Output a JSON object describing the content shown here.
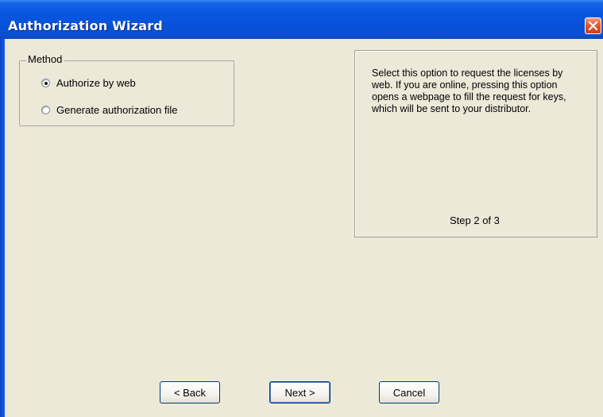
{
  "window": {
    "title": "Authorization Wizard"
  },
  "method_group": {
    "legend": "Method",
    "options": [
      {
        "label": "Authorize by web",
        "checked": true
      },
      {
        "label": "Generate authorization file",
        "checked": false
      }
    ]
  },
  "info_panel": {
    "description": "Select this option to request the licenses by web.  If you are online, pressing this option opens a webpage to fill the request for keys, which will be sent to your distributor.",
    "step": "Step 2 of 3"
  },
  "buttons": {
    "back": "< Back",
    "next": "Next >",
    "cancel": "Cancel"
  },
  "colors": {
    "titlebar": "#0650d8",
    "dialog_bg": "#ECE9D8",
    "close_button": "#e3582f"
  },
  "icons": {
    "close": "close-icon"
  }
}
